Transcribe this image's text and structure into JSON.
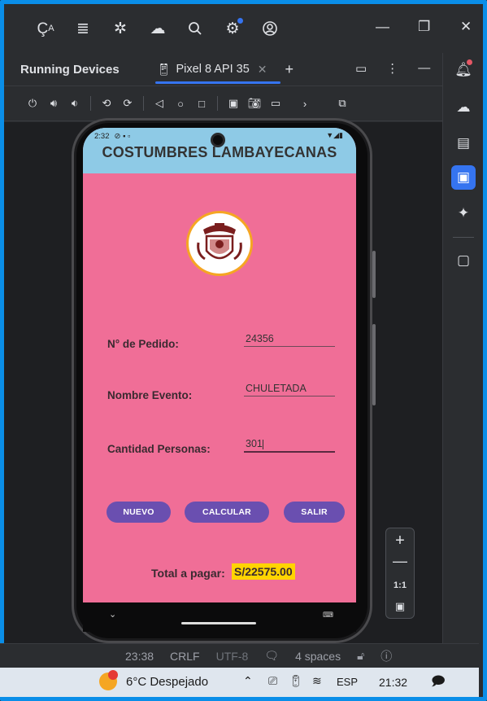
{
  "ide": {
    "panel_title": "Running Devices",
    "device_tab": "Pixel 8 API 35",
    "status": {
      "position": "23:38",
      "line_ending": "CRLF",
      "encoding": "UTF-8",
      "indent": "4 spaces"
    },
    "zoom": {
      "reset": "1:1"
    }
  },
  "phone": {
    "status_time": "2:32",
    "app_title": "COSTUMBRES LAMBAYECANAS",
    "form": {
      "pedido_label": "N° de Pedido:",
      "pedido_value": "24356",
      "evento_label": "Nombre Evento:",
      "evento_value": "CHULETADA",
      "personas_label": "Cantidad Personas:",
      "personas_value": "301"
    },
    "buttons": {
      "nuevo": "NUEVO",
      "calcular": "CALCULAR",
      "salir": "SALIR"
    },
    "total_label": "Total a pagar:",
    "total_value": "S/22575.00"
  },
  "taskbar": {
    "weather": "6°C Despejado",
    "language": "ESP",
    "clock": "21:32"
  },
  "colors": {
    "accent": "#0a8ee8",
    "app_bg": "#f06e97",
    "appbar": "#8ecae6",
    "button": "#6a4fb0",
    "total_highlight": "#ffd400"
  }
}
